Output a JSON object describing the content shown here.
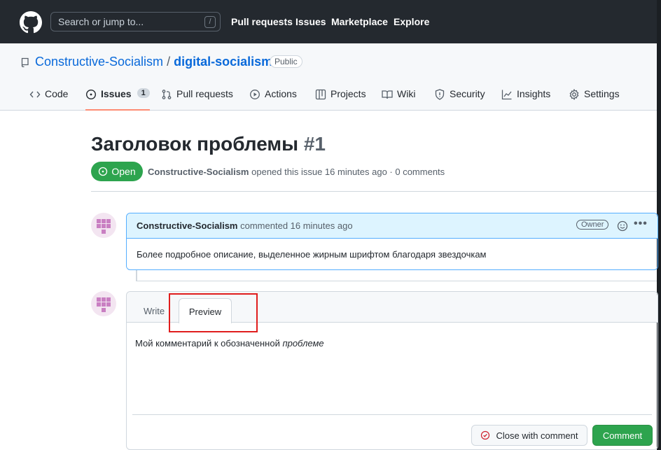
{
  "header": {
    "search_placeholder": "Search or jump to...",
    "search_shortcut": "/",
    "nav": [
      "Pull requests",
      "Issues",
      "Marketplace",
      "Explore"
    ]
  },
  "repo": {
    "owner": "Constructive-Socialism",
    "separator": "/",
    "name": "digital-socialism",
    "visibility": "Public",
    "tabs": [
      {
        "label": "Code",
        "icon": "code-icon"
      },
      {
        "label": "Issues",
        "icon": "issue-opened-icon",
        "count": "1"
      },
      {
        "label": "Pull requests",
        "icon": "git-pull-request-icon"
      },
      {
        "label": "Actions",
        "icon": "play-icon"
      },
      {
        "label": "Projects",
        "icon": "table-icon"
      },
      {
        "label": "Wiki",
        "icon": "book-icon"
      },
      {
        "label": "Security",
        "icon": "shield-icon"
      },
      {
        "label": "Insights",
        "icon": "graph-icon"
      },
      {
        "label": "Settings",
        "icon": "gear-icon"
      }
    ]
  },
  "issue": {
    "title": "Заголовок проблемы",
    "number": "#1",
    "state": "Open",
    "author": "Constructive-Socialism",
    "meta": "opened this issue 16 minutes ago · 0 comments"
  },
  "comment": {
    "author": "Constructive-Socialism",
    "action": "commented 16 minutes ago",
    "badge": "Owner",
    "more": "•••",
    "body": "Более подробное описание, выделенное жирным шрифтом благодаря звездочкам"
  },
  "editor": {
    "tab_write": "Write",
    "tab_preview": "Preview",
    "preview_plain": "Мой комментарий к обозначенной ",
    "preview_italic": "проблеме",
    "close_button": "Close with comment",
    "comment_button": "Comment"
  },
  "colors": {
    "accent": "#0969da",
    "open_green": "#2da44e",
    "highlight_red": "#e01d1d",
    "active_tab_underline": "#fd8c73"
  }
}
